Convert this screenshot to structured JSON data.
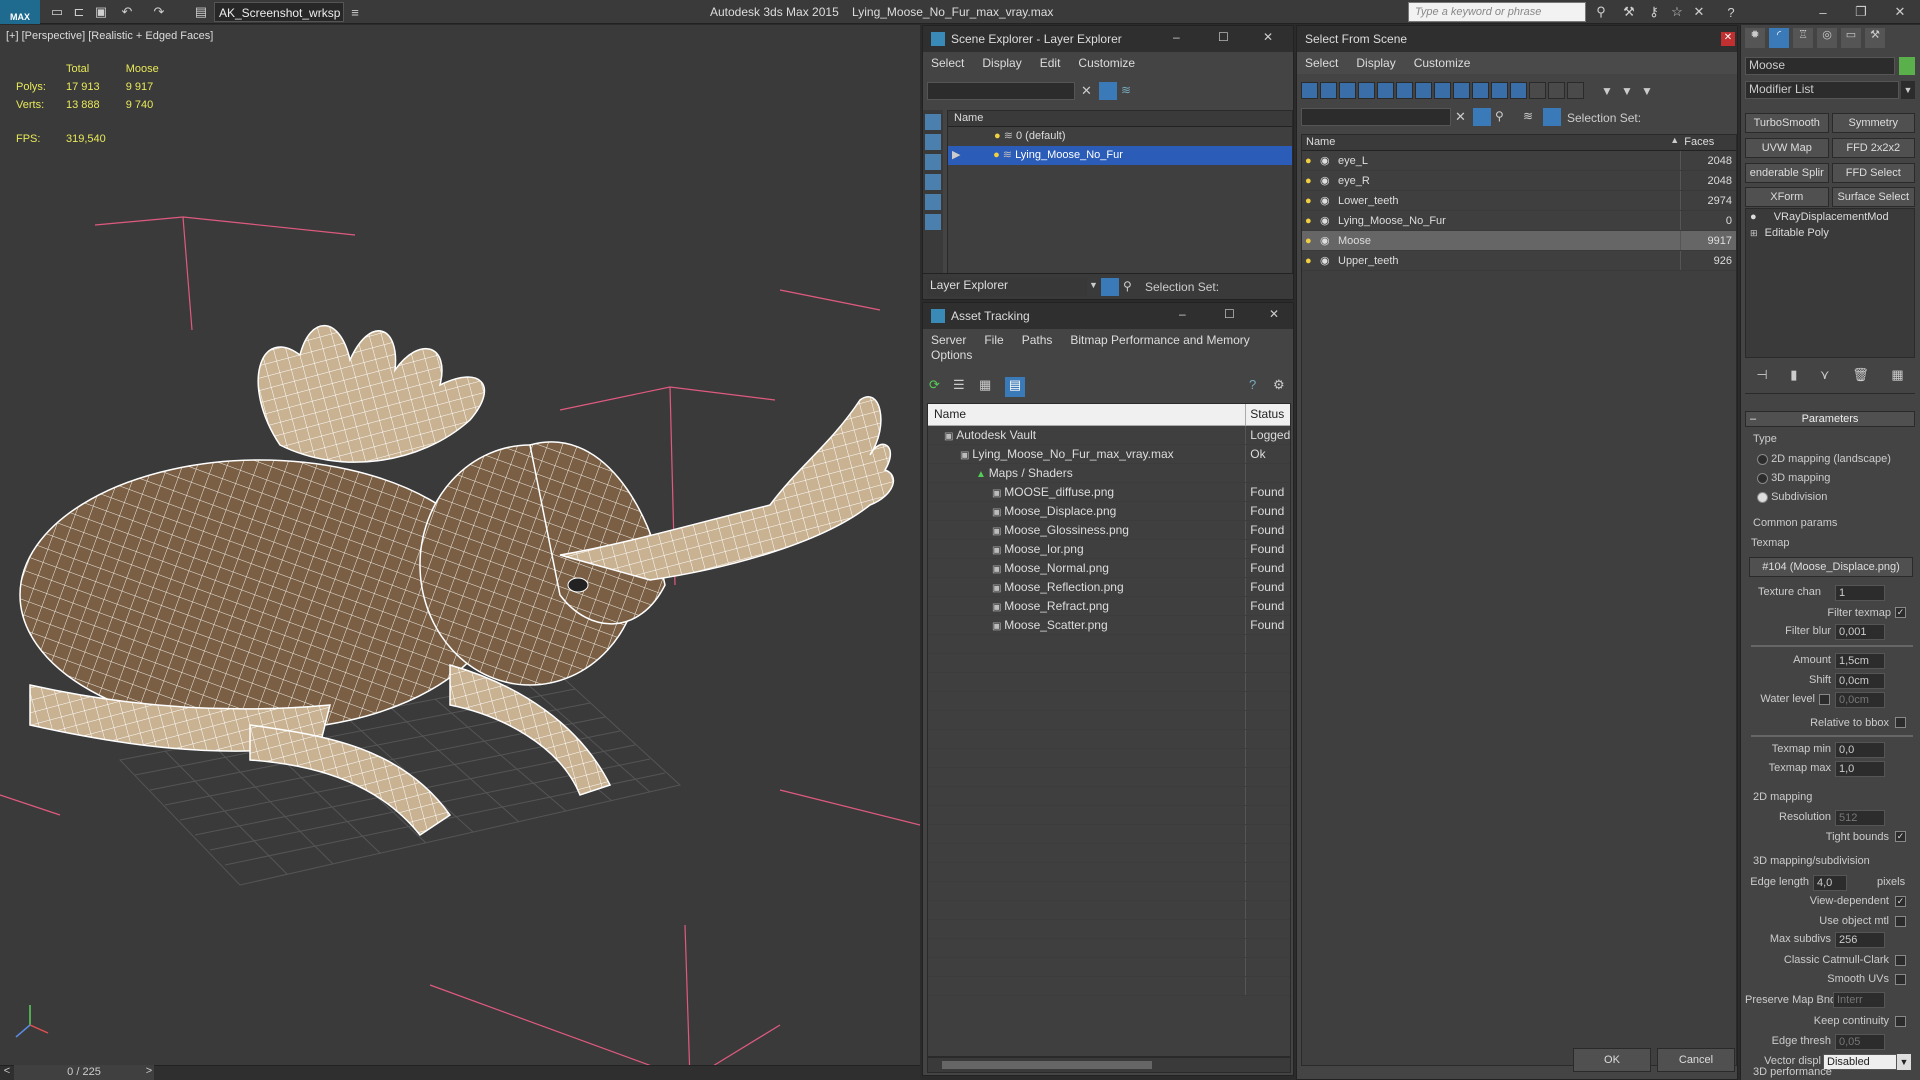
{
  "topbar": {
    "logo": "MAX",
    "workspace": "AK_Screenshot_wrksp",
    "app_name": "Autodesk 3ds Max  2015",
    "file_name": "Lying_Moose_No_Fur_max_vray.max",
    "search_placeholder": "Type a keyword or phrase"
  },
  "viewport": {
    "label": "[+] [Perspective] [Realistic + Edged Faces]",
    "stats": {
      "col_total": "Total",
      "col_object": "Moose",
      "polys_label": "Polys:",
      "polys_total": "17 913",
      "polys_object": "9 917",
      "verts_label": "Verts:",
      "verts_total": "13 888",
      "verts_object": "9 740",
      "fps_label": "FPS:",
      "fps_value": "319,540"
    },
    "timeline": "0 / 225",
    "timeline_prev": "<",
    "timeline_next": ">"
  },
  "scene_explorer": {
    "title": "Scene Explorer - Layer Explorer",
    "menu": [
      "Select",
      "Display",
      "Edit",
      "Customize"
    ],
    "column_name": "Name",
    "items": [
      {
        "label": "0 (default)",
        "selected": false
      },
      {
        "label": "Lying_Moose_No_Fur",
        "selected": true
      }
    ],
    "footer_dropdown": "Layer Explorer",
    "footer_selection": "Selection Set:"
  },
  "asset_tracking": {
    "title": "Asset Tracking",
    "menu": [
      "Server",
      "File",
      "Paths",
      "Bitmap Performance and Memory"
    ],
    "menu2": "Options",
    "col_name": "Name",
    "col_status": "Status",
    "rows": [
      {
        "name": "Autodesk Vault",
        "status": "Logged",
        "indent": 1
      },
      {
        "name": "Lying_Moose_No_Fur_max_vray.max",
        "status": "Ok",
        "indent": 2
      },
      {
        "name": "Maps / Shaders",
        "status": "",
        "indent": 3
      },
      {
        "name": "MOOSE_diffuse.png",
        "status": "Found",
        "indent": 4
      },
      {
        "name": "Moose_Displace.png",
        "status": "Found",
        "indent": 4
      },
      {
        "name": "Moose_Glossiness.png",
        "status": "Found",
        "indent": 4
      },
      {
        "name": "Moose_Ior.png",
        "status": "Found",
        "indent": 4
      },
      {
        "name": "Moose_Normal.png",
        "status": "Found",
        "indent": 4
      },
      {
        "name": "Moose_Reflection.png",
        "status": "Found",
        "indent": 4
      },
      {
        "name": "Moose_Refract.png",
        "status": "Found",
        "indent": 4
      },
      {
        "name": "Moose_Scatter.png",
        "status": "Found",
        "indent": 4
      }
    ]
  },
  "select_from_scene": {
    "title": "Select From Scene",
    "menu": [
      "Select",
      "Display",
      "Customize"
    ],
    "selection_set": "Selection Set:",
    "col_name": "Name",
    "col_faces": "Faces",
    "rows": [
      {
        "name": "eye_L",
        "faces": "2048",
        "selected": false
      },
      {
        "name": "eye_R",
        "faces": "2048",
        "selected": false
      },
      {
        "name": "Lower_teeth",
        "faces": "2974",
        "selected": false
      },
      {
        "name": "Lying_Moose_No_Fur",
        "faces": "0",
        "selected": false
      },
      {
        "name": "Moose",
        "faces": "9917",
        "selected": true
      },
      {
        "name": "Upper_teeth",
        "faces": "926",
        "selected": false
      }
    ],
    "ok": "OK",
    "cancel": "Cancel"
  },
  "command_panel": {
    "object_name": "Moose",
    "modifier_list": "Modifier List",
    "buttons": [
      "TurboSmooth",
      "Symmetry",
      "UVW Map",
      "FFD 2x2x2",
      "enderable Splir",
      "FFD Select",
      "XForm",
      "Surface Select"
    ],
    "stack": [
      "VRayDisplacementMod",
      "Editable Poly"
    ],
    "rollout_title": "Parameters",
    "type_label": "Type",
    "type_options": [
      "2D mapping (landscape)",
      "3D mapping",
      "Subdivision"
    ],
    "type_selected": 2,
    "common_params": "Common params",
    "texmap_label": "Texmap",
    "texmap_value": "#104 (Moose_Displace.png)",
    "texture_chan_label": "Texture chan",
    "texture_chan_value": "1",
    "filter_texmap_label": "Filter texmap",
    "filter_blur_label": "Filter blur",
    "filter_blur_value": "0,001",
    "amount_label": "Amount",
    "amount_value": "1,5cm",
    "shift_label": "Shift",
    "shift_value": "0,0cm",
    "water_label": "Water level",
    "water_value": "0,0cm",
    "relative_label": "Relative to bbox",
    "texmap_min_label": "Texmap min",
    "texmap_min_value": "0,0",
    "texmap_max_label": "Texmap max",
    "texmap_max_value": "1,0",
    "mapping2d": "2D mapping",
    "resolution_label": "Resolution",
    "resolution_value": "512",
    "tight_label": "Tight bounds",
    "mapping3d": "3D mapping/subdivision",
    "edge_length_label": "Edge length",
    "edge_length_value": "4,0",
    "pixels_label": "pixels",
    "view_dep_label": "View-dependent",
    "use_obj_label": "Use object mtl",
    "max_subdivs_label": "Max subdivs",
    "max_subdivs_value": "256",
    "catmull_label": "Classic Catmull-Clark",
    "smooth_uvs_label": "Smooth UVs",
    "preserve_label": "Preserve Map Bnd",
    "preserve_value": "Interr",
    "keep_cont_label": "Keep continuity",
    "edge_thresh_label": "Edge thresh",
    "edge_thresh_value": "0,05",
    "vector_label": "Vector displ",
    "vector_value": "Disabled",
    "perf_label": "3D performance"
  }
}
